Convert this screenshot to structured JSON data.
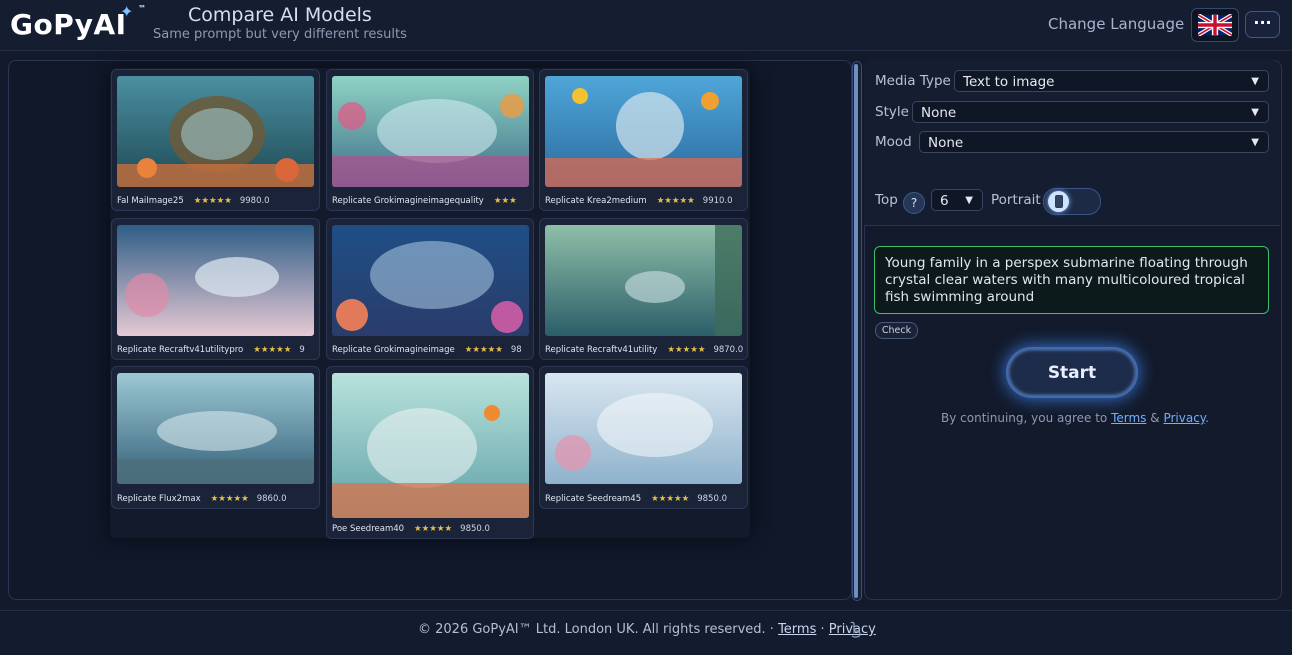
{
  "header": {
    "logo": "GoPyAI",
    "logo_tm": "™",
    "title": "Compare AI Models",
    "subtitle": "Same prompt but very different results",
    "change_language": "Change Language",
    "more_label": "···"
  },
  "results": [
    {
      "model": "Fal MaiImage25",
      "stars": "★★★★★",
      "score": "9980.0"
    },
    {
      "model": "Replicate Grokimagineimagequality",
      "stars": "★★★",
      "score": ""
    },
    {
      "model": "Replicate Krea2medium",
      "stars": "★★★★★",
      "score": "9910.0"
    },
    {
      "model": "Replicate Recraftv41utilitypro",
      "stars": "★★★★★",
      "score": "9"
    },
    {
      "model": "Replicate Grokimagineimage",
      "stars": "★★★★★",
      "score": "98"
    },
    {
      "model": "Replicate Recraftv41utility",
      "stars": "★★★★★",
      "score": "9870.0"
    },
    {
      "model": "Replicate Flux2max",
      "stars": "★★★★★",
      "score": "9860.0"
    },
    {
      "model": "Poe Seedream40",
      "stars": "★★★★★",
      "score": "9850.0"
    },
    {
      "model": "Replicate Seedream45",
      "stars": "★★★★★",
      "score": "9850.0"
    }
  ],
  "settings": {
    "media_type_label": "Media Type",
    "media_type_value": "Text to image",
    "style_label": "Style",
    "style_value": "None",
    "mood_label": "Mood",
    "mood_value": "None",
    "top_label": "Top",
    "help_label": "?",
    "top_value": "6",
    "portrait_label": "Portrait",
    "caret": "▼"
  },
  "prompt": {
    "text": "Young family in a perspex submarine floating through crystal clear waters with many multicoloured tropical fish swimming around",
    "check_label": "Check"
  },
  "start_label": "Start",
  "agreement": {
    "prefix": "By continuing, you agree to",
    "terms": "Terms",
    "amp": "&",
    "privacy": "Privacy",
    "suffix": "."
  },
  "footer": {
    "copyright": "© 2026 GoPyAI™ Ltd. London UK. All rights reserved. ·",
    "terms": "Terms",
    "sep": "·",
    "privacy": "Privacy"
  },
  "colors": {
    "accent": "#5fb3ff",
    "prompt_border": "#3bbf6a",
    "stars": "#e7c04a"
  }
}
